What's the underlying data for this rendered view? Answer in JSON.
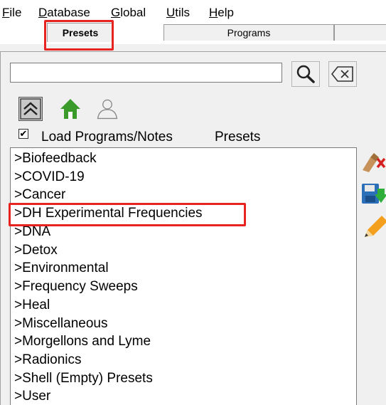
{
  "menubar": {
    "file": {
      "key": "F",
      "rest": "ile"
    },
    "database": {
      "key": "D",
      "rest": "atabase"
    },
    "global": {
      "key": "G",
      "rest": "lobal"
    },
    "utils": {
      "key": "U",
      "rest": "tils"
    },
    "help": {
      "key": "H",
      "rest": "elp"
    }
  },
  "tabs": [
    {
      "label": "Presets",
      "active": true
    },
    {
      "label": "Programs",
      "active": false
    }
  ],
  "search": {
    "value": "",
    "placeholder": ""
  },
  "toolbar": {
    "search_icon": "magnifier-icon",
    "clear_icon": "backspace-clear-icon",
    "up_icon": "up-arrow-icon",
    "home_icon": "home-icon",
    "user_icon": "user-outline-icon"
  },
  "options": {
    "load_checked": true,
    "check_mark": "✔",
    "load_label": "Load Programs/Notes",
    "section_label": "Presets"
  },
  "list": {
    "items": [
      ">Biofeedback",
      ">COVID-19",
      ">Cancer",
      ">DH Experimental Frequencies",
      ">DNA",
      ">Detox",
      ">Environmental",
      ">Frequency Sweeps",
      ">Heal",
      ">Miscellaneous",
      ">Morgellons and Lyme",
      ">Radionics",
      ">Shell (Empty) Presets",
      ">User"
    ],
    "highlighted_index": 3
  },
  "side_buttons": [
    "delete-icon",
    "save-download-icon",
    "edit-pencil-icon"
  ],
  "colors": {
    "highlight": "#e8231f",
    "home_green": "#3a9a2a"
  }
}
